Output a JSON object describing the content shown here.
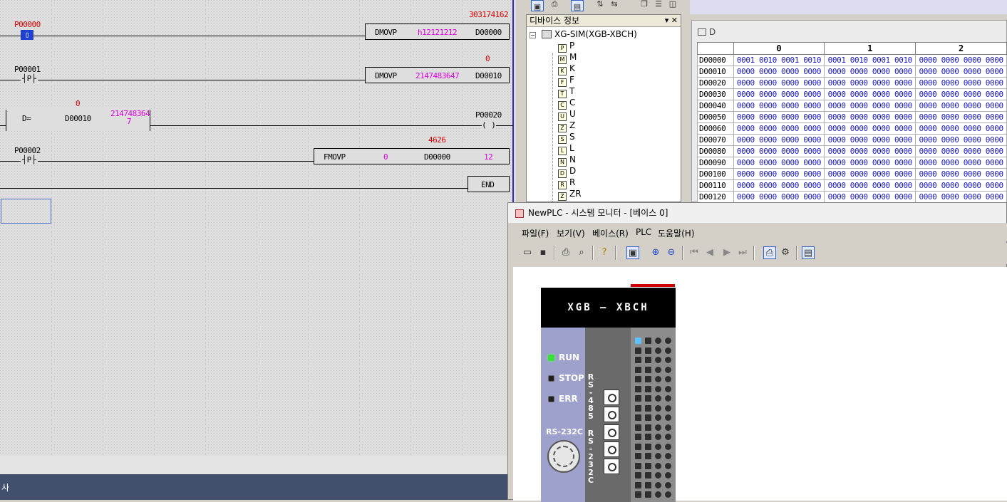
{
  "ladder": {
    "rung1": {
      "contact": "P00000",
      "contact_value_color": "#e00000",
      "instr": "DMOVP",
      "src": "h12121212",
      "dst": "D00000",
      "monitor": "303174162"
    },
    "rung2": {
      "contact": "P00001",
      "contact_symbol": "P",
      "instr": "DMOVP",
      "src": "2147483647",
      "dst": "D00010",
      "monitor": "0"
    },
    "rung3": {
      "compare": "D=",
      "op1": "D00010",
      "op1_value": "0",
      "op2_line1": "214748364",
      "op2_line2": "7",
      "coil": "P00020"
    },
    "rung4": {
      "contact": "P00002",
      "contact_symbol": "P",
      "instr": "FMOVP",
      "src": "0",
      "dst": "D00000",
      "count": "12",
      "monitor": "4626"
    },
    "end_label": "END"
  },
  "bottom": {
    "label": "사"
  },
  "device_pane": {
    "title": "디바이스 정보",
    "controls": "▾ ✕",
    "root": "XG-SIM(XGB-XBCH)",
    "items": [
      "P",
      "M",
      "K",
      "F",
      "T",
      "C",
      "U",
      "Z",
      "S",
      "L",
      "N",
      "D",
      "R",
      "ZR"
    ]
  },
  "memory": {
    "device": "D",
    "columns": [
      "0",
      "1",
      "2"
    ],
    "rows": [
      {
        "addr": "D00000",
        "v": [
          "0001 0010 0001 0010",
          "0001 0010 0001 0010",
          "0000 0000 0000 0000"
        ]
      },
      {
        "addr": "D00010",
        "v": [
          "0000 0000 0000 0000",
          "0000 0000 0000 0000",
          "0000 0000 0000 0000"
        ]
      },
      {
        "addr": "D00020",
        "v": [
          "0000 0000 0000 0000",
          "0000 0000 0000 0000",
          "0000 0000 0000 0000"
        ]
      },
      {
        "addr": "D00030",
        "v": [
          "0000 0000 0000 0000",
          "0000 0000 0000 0000",
          "0000 0000 0000 0000"
        ]
      },
      {
        "addr": "D00040",
        "v": [
          "0000 0000 0000 0000",
          "0000 0000 0000 0000",
          "0000 0000 0000 0000"
        ]
      },
      {
        "addr": "D00050",
        "v": [
          "0000 0000 0000 0000",
          "0000 0000 0000 0000",
          "0000 0000 0000 0000"
        ]
      },
      {
        "addr": "D00060",
        "v": [
          "0000 0000 0000 0000",
          "0000 0000 0000 0000",
          "0000 0000 0000 0000"
        ]
      },
      {
        "addr": "D00070",
        "v": [
          "0000 0000 0000 0000",
          "0000 0000 0000 0000",
          "0000 0000 0000 0000"
        ]
      },
      {
        "addr": "D00080",
        "v": [
          "0000 0000 0000 0000",
          "0000 0000 0000 0000",
          "0000 0000 0000 0000"
        ]
      },
      {
        "addr": "D00090",
        "v": [
          "0000 0000 0000 0000",
          "0000 0000 0000 0000",
          "0000 0000 0000 0000"
        ]
      },
      {
        "addr": "D00100",
        "v": [
          "0000 0000 0000 0000",
          "0000 0000 0000 0000",
          "0000 0000 0000 0000"
        ]
      },
      {
        "addr": "D00110",
        "v": [
          "0000 0000 0000 0000",
          "0000 0000 0000 0000",
          "0000 0000 0000 0000"
        ]
      },
      {
        "addr": "D00120",
        "v": [
          "0000 0000 0000 0000",
          "0000 0000 0000 0000",
          "0000 0000 0000 0000"
        ]
      }
    ]
  },
  "sysmon": {
    "title": "NewPLC - 시스템 모니터 - [베이스 0]",
    "menu": [
      "파일(F)",
      "보기(V)",
      "베이스(R)",
      "PLC",
      "도움말(H)"
    ],
    "plc_model": "XGB — XBCH",
    "leds": [
      {
        "label": "RUN",
        "color": "#38e038"
      },
      {
        "label": "STOP",
        "color": "#202020"
      },
      {
        "label": "ERR",
        "color": "#202020"
      }
    ],
    "rs232c": "RS-232C",
    "rs485_v": "RS-485",
    "rs232c_v": "RS-232C"
  }
}
